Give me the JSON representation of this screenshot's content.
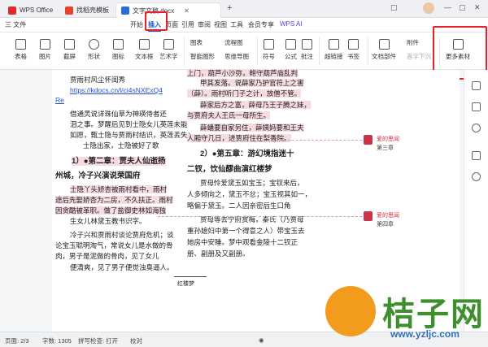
{
  "tabs": [
    {
      "label": "WPS Office",
      "color": "#e02b2b"
    },
    {
      "label": "找稻壳模板",
      "color": "#e3422d"
    },
    {
      "label": "文字文稿.docx",
      "color": "#2a6be0"
    }
  ],
  "menu": {
    "file": "三 文件",
    "items": [
      "开始",
      "插入",
      "页面",
      "引用",
      "审阅",
      "视图",
      "工具",
      "会员专享"
    ],
    "wps_ai": "WPS AI",
    "active": "插入"
  },
  "ribbon": {
    "row1": [
      "图表"
    ],
    "items": [
      "表格",
      "图片",
      "截屏",
      "形状",
      "图标",
      "文本框",
      "艺术字",
      "智能图形",
      "流程图",
      "思维导图",
      "符号",
      "公式",
      "批注",
      "超链接",
      "书签",
      "文档部件",
      "附件",
      "首字下沉",
      "更多素材"
    ]
  },
  "document": {
    "left_lines": [
      "贾雨村风尘怀闺秀",
      "https://kdocs.cn/l/ci4sNXExQ4",
      "Re",
      "借通灵说详珠仙草为神瑛侍者还",
      "泪之事。梦醒后见到士隐女儿英莲未能",
      "如愿，甄士隐与贾雨村结识，英莲丢失；",
      "士隐出家，士隐被好了歌",
      "1）●第二章：贾夫人仙逝扬",
      "州城，冷子兴演说荣国府",
      "士隐丫头娇杏被雨村看中，雨村",
      "途后先娶娇杏为二房，不久扶正。雨村",
      "因贪酷被革职。做了盐御史林如海独",
      "生女儿林黛玉教书识字。",
      "冷子兴和贾雨村谈论贾府危机；谈",
      "论宝玉聪明淘气，常说女儿是水做的骨",
      "肉，男子是泥做的骨肉，见了女儿",
      "便清爽，见了男子便觉浊臭逼人。"
    ],
    "right_lines": [
      "上门，葫芦小沙弥，鲍守葫芦庙乱判",
      "甲其发落。说薛家乃护官符上之害",
      "（薛）。雨村听门子之计，放僧不管。",
      "薛家后方之富，薛母乃王子腾之妹，",
      "与贾府夫人王氏一母所生。",
      "薛蟠要自家另住，薛姨妈要和王夫",
      "人厢守几日，进贾府住在梨香院。",
      "2）●第五章：游幻境指迷十",
      "二钗，饮仙醪曲演红楼梦",
      "贾母怜爱黛玉如宝玉；宝钗来后，",
      "人多倾向之，黛玉不忿；宝玉视其如一，",
      "略偏于黛玉。二人因亲密后生口角",
      "贾母等去宁府赏梅，秦氏（乃贾母",
      "重孙媳妇中第一个得意之人）带宝玉去",
      "她房中安睡。梦中观看金陵十二钗正",
      "册、副册及又副册。"
    ],
    "footer_note": "红楼梦"
  },
  "comments": [
    {
      "author": "爱的思闻",
      "text": "第三章"
    },
    {
      "author": "爱的思闻",
      "text": "第四章"
    }
  ],
  "status": {
    "page": "页面: 2/3",
    "words": "字数: 1305",
    "spell": "拼写检查: 打开",
    "proof": "校对"
  },
  "watermark": {
    "text": "桔子网",
    "url": "www.yzljc.com"
  },
  "colors": {
    "accent": "#1a5fd0",
    "highlight_box": "#e8202a",
    "comment": "#c9344a"
  }
}
